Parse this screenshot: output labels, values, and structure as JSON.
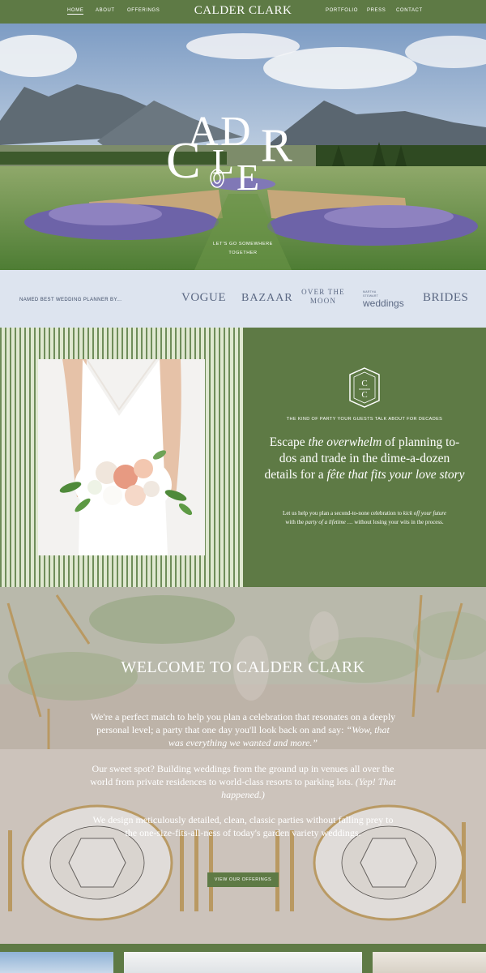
{
  "nav": {
    "left": [
      "HOME",
      "ABOUT",
      "OFFERINGS"
    ],
    "brand": "CALDER CLARK",
    "right": [
      "PORTFOLIO",
      "PRESS",
      "CONTACT"
    ]
  },
  "hero": {
    "monogram_letters": "CALDER",
    "tagline_line1": "LET'S GO SOMEWHERE",
    "tagline_line2": "TOGETHER"
  },
  "press": {
    "label": "NAMED BEST WEDDING PLANNER BY...",
    "logos": {
      "vogue": "VOGUE",
      "bazaar": "BAZAAR",
      "moon_line1": "OVER THE",
      "moon_line2": "MOON",
      "weddings_small1": "MARTHA",
      "weddings_small2": "STEWART",
      "weddings_big": "weddings",
      "brides": "BRIDES"
    }
  },
  "intro": {
    "tag": "THE KIND OF PARTY YOUR GUESTS TALK ABOUT FOR DECADES",
    "head_a": "Escape ",
    "head_b": "the overwhelm",
    "head_c": " of planning to-dos and trade in the dime-a-dozen details for a ",
    "head_d": "fête that fits your love story",
    "body_a": "Let us help you plan a second-to-none celebration to ",
    "body_b": "kick off your future",
    "body_c": " with the ",
    "body_d": "party of a lifetime",
    "body_e": " … without losing your wits in the process."
  },
  "welcome": {
    "title": "WELCOME TO CALDER CLARK",
    "p1_a": "We're a perfect match to help you plan a celebration that resonates on a deeply personal level; a party that one day you'll look back on and say: ",
    "p1_b": "“Wow, that was everything we wanted and more.”",
    "p2_a": "Our sweet spot? Building weddings from the ground up in venues all over the world from private residences to world-class resorts to parking lots. ",
    "p2_b": "(Yep! That happened.)",
    "p3": "We design meticulously detailed, clean, classic parties without falling prey to the one-size-fits-all-ness of today's garden variety weddings.",
    "cta": "VIEW OUR OFFERINGS"
  },
  "colors": {
    "brand_green": "#5e7a45",
    "press_bg": "#dde4ef",
    "press_text": "#5b6883",
    "stripe_light": "#dfe8d0"
  }
}
